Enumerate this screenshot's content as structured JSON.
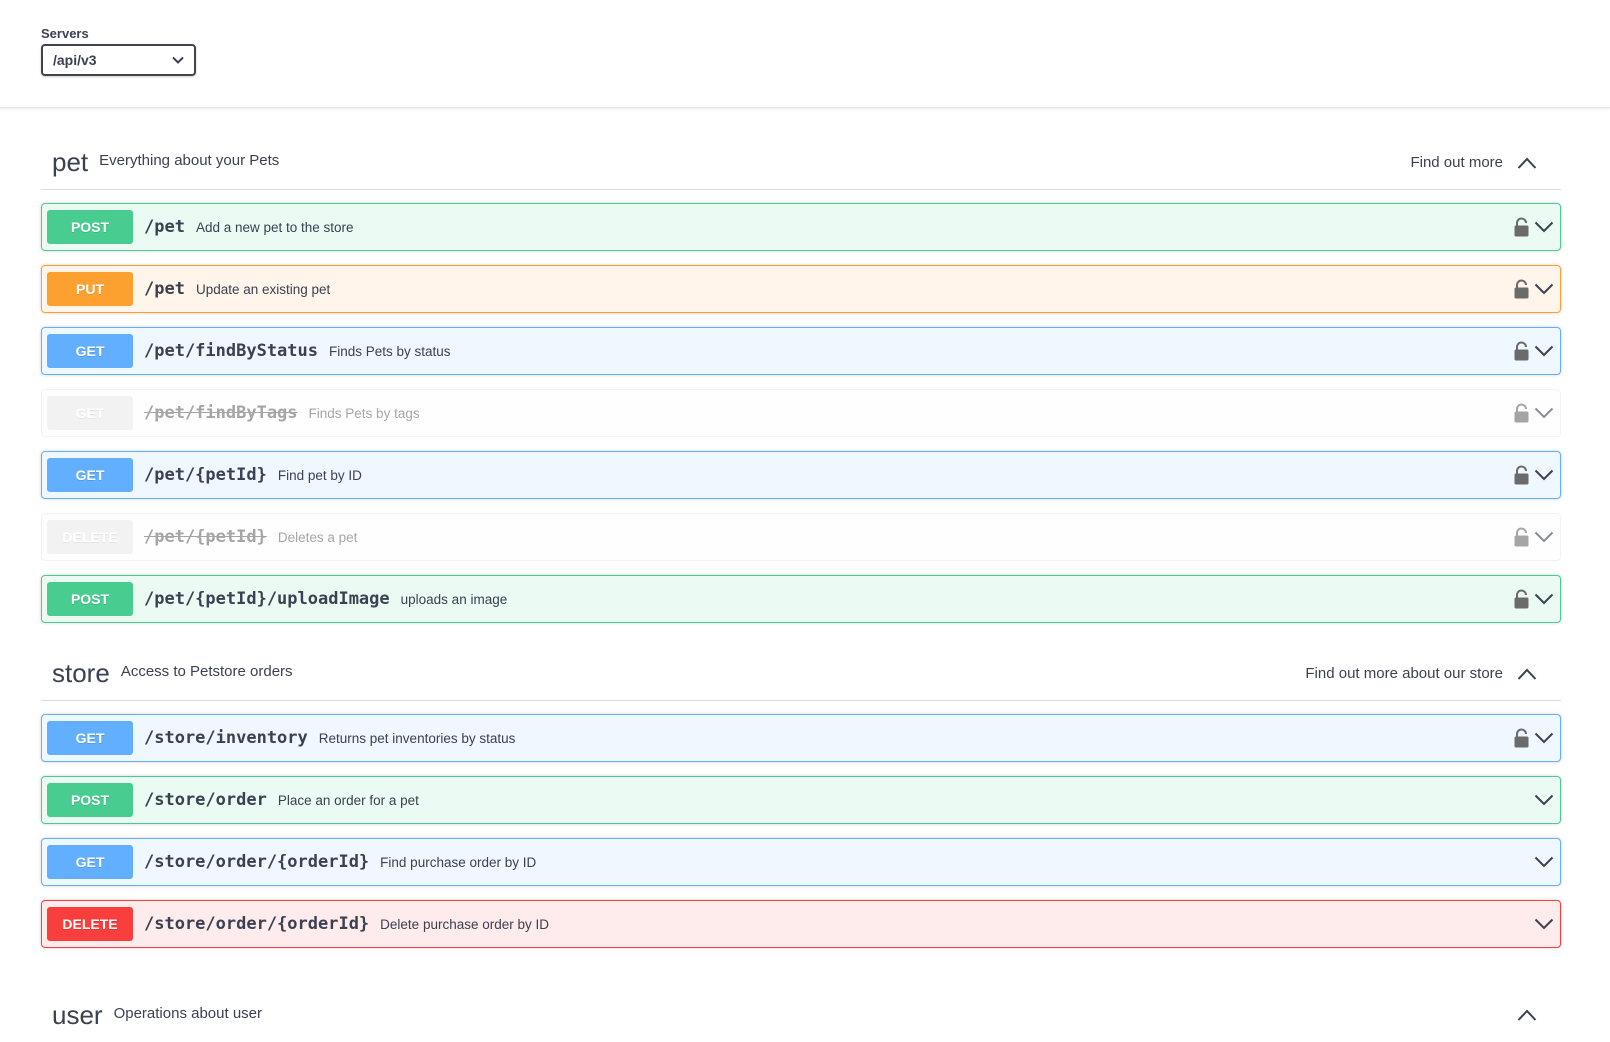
{
  "servers": {
    "label": "Servers",
    "selected": "/api/v3"
  },
  "tags": {
    "pet": {
      "name": "pet",
      "description": "Everything about your Pets",
      "link": "Find out more",
      "operations": [
        {
          "method": "POST",
          "path": "/pet",
          "summary": "Add a new pet to the store",
          "locked": true,
          "deprecated": false
        },
        {
          "method": "PUT",
          "path": "/pet",
          "summary": "Update an existing pet",
          "locked": true,
          "deprecated": false
        },
        {
          "method": "GET",
          "path": "/pet/findByStatus",
          "summary": "Finds Pets by status",
          "locked": true,
          "deprecated": false
        },
        {
          "method": "GET",
          "path": "/pet/findByTags",
          "summary": "Finds Pets by tags",
          "locked": true,
          "deprecated": true
        },
        {
          "method": "GET",
          "path": "/pet/{petId}",
          "summary": "Find pet by ID",
          "locked": true,
          "deprecated": false
        },
        {
          "method": "DELETE",
          "path": "/pet/{petId}",
          "summary": "Deletes a pet",
          "locked": true,
          "deprecated": true
        },
        {
          "method": "POST",
          "path": "/pet/{petId}/uploadImage",
          "summary": "uploads an image",
          "locked": true,
          "deprecated": false
        }
      ]
    },
    "store": {
      "name": "store",
      "description": "Access to Petstore orders",
      "link": "Find out more about our store",
      "operations": [
        {
          "method": "GET",
          "path": "/store/inventory",
          "summary": "Returns pet inventories by status",
          "locked": true,
          "deprecated": false
        },
        {
          "method": "POST",
          "path": "/store/order",
          "summary": "Place an order for a pet",
          "locked": false,
          "deprecated": false
        },
        {
          "method": "GET",
          "path": "/store/order/{orderId}",
          "summary": "Find purchase order by ID",
          "locked": false,
          "deprecated": false
        },
        {
          "method": "DELETE",
          "path": "/store/order/{orderId}",
          "summary": "Delete purchase order by ID",
          "locked": false,
          "deprecated": false
        }
      ]
    },
    "user": {
      "name": "user",
      "description": "Operations about user"
    }
  },
  "colors": {
    "post": "#49cc90",
    "put": "#fca130",
    "get": "#61affe",
    "delete": "#f93e3e",
    "deprecated": "#ebebeb"
  },
  "icons": {
    "lock": "lock-icon",
    "expand": "chevron-down-icon",
    "collapse": "chevron-up-icon",
    "select": "chevron-down-icon"
  }
}
